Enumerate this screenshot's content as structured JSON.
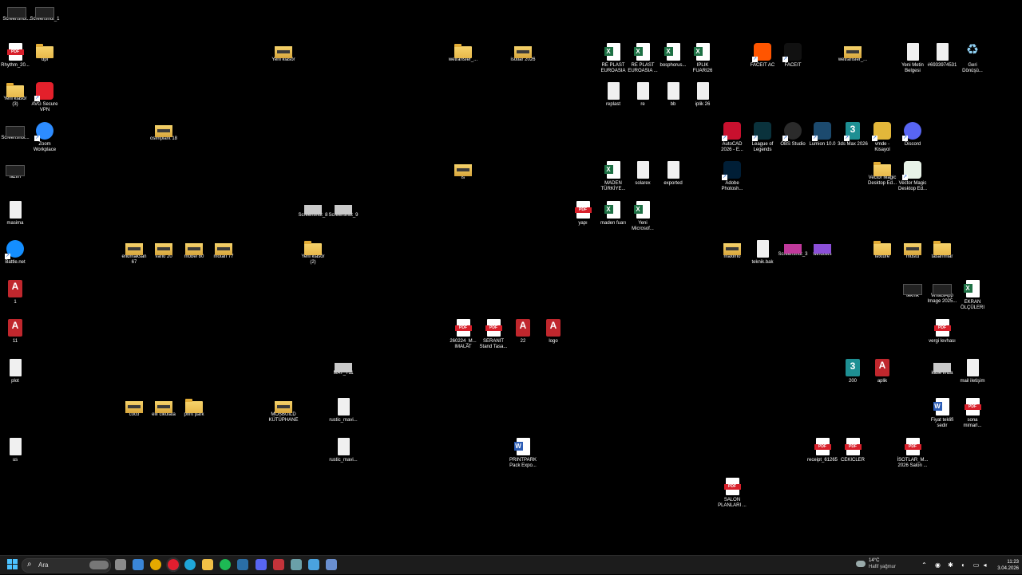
{
  "desktop": {
    "icons": [
      {
        "label": "Screenshot...",
        "type": "shotdark"
      },
      {
        "label": "Screenshot_1",
        "type": "shotdark"
      },
      {
        "label": "Rhythm_20...",
        "type": "pdf"
      },
      {
        "label": "dpi",
        "type": "folder"
      },
      {
        "label": "Yeni klasör\n(3)",
        "type": "folder"
      },
      {
        "label": "AVG Secure\nVPN",
        "type": "app",
        "color": "#e3202b",
        "shortcut": true
      },
      {
        "label": "Screenshot...",
        "type": "shotdark"
      },
      {
        "label": "Zoom\nWorkplace",
        "type": "round",
        "color": "#2d8cff",
        "shortcut": true
      },
      {
        "label": "lazim",
        "type": "shotdark"
      },
      {
        "label": "masima",
        "type": "file"
      },
      {
        "label": "Battle.net",
        "type": "round",
        "color": "#148eff",
        "shortcut": true
      },
      {
        "label": "1",
        "type": "access"
      },
      {
        "label": "11",
        "type": "access"
      },
      {
        "label": "plot",
        "type": "file"
      },
      {
        "label": "us",
        "type": "file"
      },
      {
        "label": "osimplant 18",
        "type": "folderzip"
      },
      {
        "label": "endmaksan\n67",
        "type": "folderzip"
      },
      {
        "label": "vario 20",
        "type": "folderzip"
      },
      {
        "label": "mobel 80",
        "type": "folderzip"
      },
      {
        "label": "motan 77",
        "type": "folderzip"
      },
      {
        "label": "coco",
        "type": "folderzip"
      },
      {
        "label": "elif cikolata",
        "type": "folderzip"
      },
      {
        "label": "print park",
        "type": "folder"
      },
      {
        "label": "Yeni klasör",
        "type": "folderzip"
      },
      {
        "label": "Screenshot_8",
        "type": "shot"
      },
      {
        "label": "Screenshot_9",
        "type": "shot"
      },
      {
        "label": "Yeni klasör\n(2)",
        "type": "folder"
      },
      {
        "label": "MAT_711",
        "type": "shot"
      },
      {
        "label": "MOSBUILD\nKÜTÜPHANE",
        "type": "folderzip"
      },
      {
        "label": "rustic_mavi...",
        "type": "file"
      },
      {
        "label": "rustic_mavi...",
        "type": "file"
      },
      {
        "label": "wetransfer_...",
        "type": "folder"
      },
      {
        "label": "isotlar 2026",
        "type": "folderzip"
      },
      {
        "label": "is",
        "type": "folderzip"
      },
      {
        "label": "260224_M...\nIMALAT",
        "type": "pdf"
      },
      {
        "label": "SERANIT\nStand Tasa...",
        "type": "pdf"
      },
      {
        "label": "22",
        "type": "access"
      },
      {
        "label": "logo",
        "type": "access"
      },
      {
        "label": "yapı",
        "type": "pdf"
      },
      {
        "label": "PRINTPARK\nPack Expo...",
        "type": "doc"
      },
      {
        "label": "RE PLAST\nEUROASIA",
        "type": "xls"
      },
      {
        "label": "RE PLAST\nEUROASIA ...",
        "type": "xls"
      },
      {
        "label": "bosphorus...",
        "type": "xls"
      },
      {
        "label": "IPLIK\nFUARI26",
        "type": "xls"
      },
      {
        "label": "replast",
        "type": "file"
      },
      {
        "label": "re",
        "type": "file"
      },
      {
        "label": "bb",
        "type": "file"
      },
      {
        "label": "iplik 26",
        "type": "file"
      },
      {
        "label": "MADEN\nTÜRKİYE...",
        "type": "xls"
      },
      {
        "label": "solarex",
        "type": "file"
      },
      {
        "label": "exported",
        "type": "file"
      },
      {
        "label": "maden fuarı",
        "type": "xls"
      },
      {
        "label": "Yeni\nMicrosof...",
        "type": "xls"
      },
      {
        "label": "FACEIT AC",
        "type": "app",
        "color": "#ff5500",
        "shortcut": true
      },
      {
        "label": "FACEIT",
        "type": "app",
        "color": "#111111",
        "shortcut": true
      },
      {
        "label": "AutoCAD\n2026 - E...",
        "type": "app",
        "color": "#c8102e",
        "shortcut": true
      },
      {
        "label": "League of\nLegends",
        "type": "app",
        "color": "#0a323c",
        "shortcut": true
      },
      {
        "label": "OBS Studio",
        "type": "round",
        "color": "#2b2b2b",
        "shortcut": true
      },
      {
        "label": "Lumion 10.0",
        "type": "app",
        "color": "#1c4a6e",
        "shortcut": true
      },
      {
        "label": "3ds Max 2026",
        "type": "max",
        "shortcut": true
      },
      {
        "label": "Adobe\nPhotosh...",
        "type": "app",
        "color": "#001e36",
        "shortcut": true
      },
      {
        "label": "maximo",
        "type": "folderzip"
      },
      {
        "label": "teknik.bak",
        "type": "file"
      },
      {
        "label": "Screenshot_3",
        "type": "shot",
        "color": "#c0399b"
      },
      {
        "label": "windows",
        "type": "shot",
        "color": "#8b4fd8"
      },
      {
        "label": "200",
        "type": "max"
      },
      {
        "label": "aplik",
        "type": "access"
      },
      {
        "label": "receipt_61265",
        "type": "pdf"
      },
      {
        "label": "CEKICLER",
        "type": "pdf"
      },
      {
        "label": "SALON\nPLANLARI ...",
        "type": "pdf"
      },
      {
        "label": "wetransfer_...",
        "type": "folderzip"
      },
      {
        "label": "vmde -\nKisayol",
        "type": "app",
        "color": "#e3b73a",
        "shortcut": true
      },
      {
        "label": "Discord",
        "type": "round",
        "color": "#5865f2",
        "shortcut": true
      },
      {
        "label": "Vector Magic\nDesktop Ed...",
        "type": "folder"
      },
      {
        "label": "Vector Magic\nDesktop Ed...",
        "type": "app",
        "color": "#e8f3e8",
        "shortcut": true
      },
      {
        "label": "texture",
        "type": "folder"
      },
      {
        "label": "müstü",
        "type": "folderzip"
      },
      {
        "label": "tasarımlar",
        "type": "folder"
      },
      {
        "label": "teknik",
        "type": "shotdark"
      },
      {
        "label": "İSOTLAR_M...\n2026 Salon ...",
        "type": "pdf"
      },
      {
        "label": "Yeni Metin\nBelgesi",
        "type": "file"
      },
      {
        "label": "#6933974531",
        "type": "file"
      },
      {
        "label": "Geri\nDönüşü...",
        "type": "recycle"
      },
      {
        "label": "WhatsApp\nImage 2025...",
        "type": "shotdark"
      },
      {
        "label": "EKRAN\nÖLÇÜLERI",
        "type": "xls"
      },
      {
        "label": "vergi levhası",
        "type": "pdf"
      },
      {
        "label": "kase imza",
        "type": "shot"
      },
      {
        "label": "mail iletişim",
        "type": "file"
      },
      {
        "label": "Fiyat teklifi\nsedir",
        "type": "doc"
      },
      {
        "label": "sona\nmimarl...",
        "type": "pdf"
      }
    ]
  },
  "taskbar": {
    "search_placeholder": "Ara",
    "apps": [
      {
        "name": "task-view-icon",
        "color": "#8a8a8a"
      },
      {
        "name": "mail-app-icon",
        "color": "#3a86d8"
      },
      {
        "name": "chrome-icon",
        "color": "#e4a900"
      },
      {
        "name": "opera-icon",
        "color": "#e21e2f"
      },
      {
        "name": "edge-icon",
        "color": "#1fa6d8"
      },
      {
        "name": "file-explorer-icon",
        "color": "#f2c046"
      },
      {
        "name": "spotify-icon",
        "color": "#1db954"
      },
      {
        "name": "steam-icon",
        "color": "#2a6ea6"
      },
      {
        "name": "discord-taskbar-icon",
        "color": "#5865f2"
      },
      {
        "name": "settings-app-icon",
        "color": "#c3333a"
      },
      {
        "name": "network-tool-icon",
        "color": "#6aa0a8"
      },
      {
        "name": "notepad-icon",
        "color": "#4aa3df"
      },
      {
        "name": "document-app-icon",
        "color": "#6a8fd0"
      }
    ],
    "weather": {
      "temp": "14°C",
      "condition": "Hafif yağmur"
    },
    "clock": {
      "time": "11:23",
      "date": "3.04.2026"
    }
  }
}
